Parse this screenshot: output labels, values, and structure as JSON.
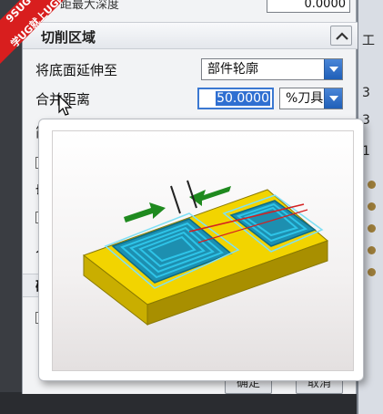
{
  "dialog": {
    "top_field": {
      "label": "步距最大深度",
      "value": "0.0000"
    },
    "section": {
      "title": "切削区域",
      "collapse_symbol": "∧"
    },
    "fields": [
      {
        "label": "将底面延伸至",
        "value": "部件轮廓"
      },
      {
        "label": "合并距离",
        "value": "50.0000",
        "unit": "%刀具"
      }
    ],
    "hidden_labels": [
      "简",
      "切",
      "入"
    ],
    "subsection_label": "确",
    "buttons": {
      "ok": "确定",
      "cancel": "取消"
    }
  },
  "right_panel": {
    "items": [
      "工",
      "3",
      "3",
      "1"
    ]
  },
  "watermark": {
    "line1": "9SUG",
    "line2": "学UG就上UG网"
  },
  "colors": {
    "accent": "#1f5fb8",
    "part": "#f2d400",
    "toolpath": "#2ec4e8",
    "arrow": "#1f8a1f",
    "watermark": "#d81e1e"
  }
}
